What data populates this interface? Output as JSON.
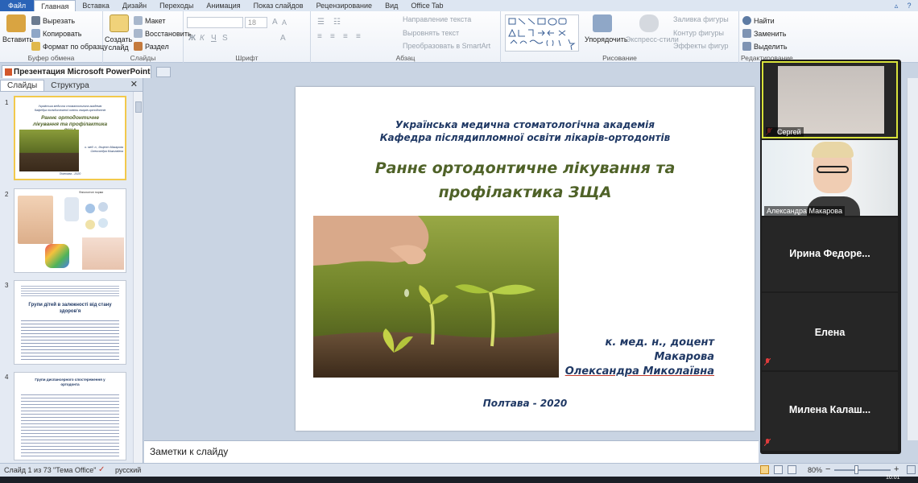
{
  "ribbon_tabs": [
    "Файл",
    "Главная",
    "Вставка",
    "Дизайн",
    "Переходы",
    "Анимация",
    "Показ слайдов",
    "Рецензирование",
    "Вид",
    "Office Tab"
  ],
  "active_tab": "Главная",
  "clipboard": {
    "paste": "Вставить",
    "cut": "Вырезать",
    "copy": "Копировать",
    "format": "Формат по образцу",
    "label": "Буфер обмена"
  },
  "slides_group": {
    "new_slide": "Создать слайд",
    "layout": "Макет",
    "reset": "Восстановить",
    "section": "Раздел",
    "label": "Слайды"
  },
  "font_group": {
    "size": "18",
    "label": "Шрифт"
  },
  "paragraph": {
    "direction": "Направление текста",
    "align": "Выровнять текст",
    "smartart": "Преобразовать в SmartArt",
    "label": "Абзац"
  },
  "drawing": {
    "arrange": "Упорядочить",
    "quick_styles": "Экспресс-стили",
    "fill": "Заливка фигуры",
    "outline": "Контур фигуры",
    "effects": "Эффекты фигур",
    "label": "Рисование"
  },
  "editing": {
    "find": "Найти",
    "replace": "Заменить",
    "select": "Выделить",
    "label": "Редактирование"
  },
  "document_tab": "Презентация Microsoft PowerPoint",
  "pane_tabs": {
    "slides": "Слайды",
    "outline": "Структура"
  },
  "thumbnails": [
    {
      "num": "1",
      "line1": "Українська медична стоматологічна академія",
      "line2": "Кафедра післядипломної освіти лікарів-ортодонтів",
      "title": "Раннє ортодонтичне лікування та профілактика ЗЩА",
      "author": "к. мед. н., доцент Макарова Олександра Миколаївна",
      "city": "Полтава - 2020"
    },
    {
      "num": "2",
      "caption": "Фізіологічні норми"
    },
    {
      "num": "3",
      "title": "Групи дітей в залежності від стану здоров'я"
    },
    {
      "num": "4",
      "title": "Групи диспансерного спостереження у ортодонта"
    }
  ],
  "slide": {
    "academy": "Українська медична стоматологічна академія",
    "department": "Кафедра післядипломної освіти лікарів-ортодонтів",
    "title_line1": "Раннє ортодонтичне лікування та",
    "title_line2": "профілактика ЗЩА",
    "author_line1": "к. мед. н., доцент",
    "author_line2": "Макарова",
    "author_line3": "Олександра Миколаївна",
    "footer": "Полтава - 2020"
  },
  "notes_placeholder": "Заметки к слайду",
  "status": {
    "slide_of": "Слайд 1 из 73",
    "theme": "\"Тема Office\"",
    "language": "русский",
    "zoom": "80%",
    "time": "10:01"
  },
  "participants": [
    {
      "name": "Сергей",
      "video": true,
      "speaking": true
    },
    {
      "name": "Александра Макарова",
      "video": true
    },
    {
      "name": "Ирина  Федоре...",
      "video": false
    },
    {
      "name": "Елена",
      "video": false
    },
    {
      "name": "Милена  Калаш...",
      "video": false
    }
  ],
  "colors": {
    "slide_title": "#4f6228",
    "slide_blue": "#1f3864",
    "ribbon_file": "#2a63b7",
    "selection": "#f2c94c"
  }
}
